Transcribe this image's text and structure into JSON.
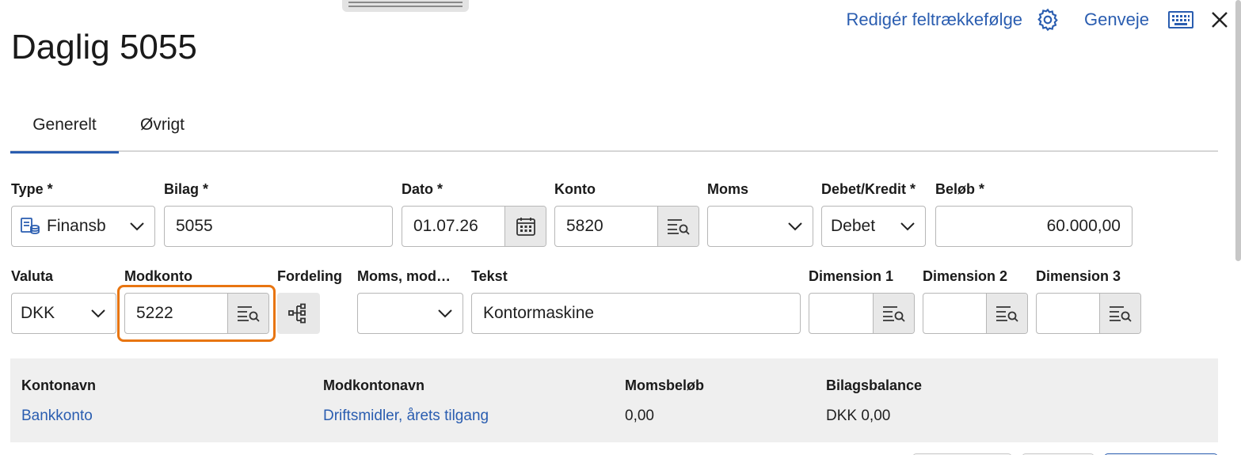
{
  "header": {
    "title": "Daglig 5055",
    "edit_order_label": "Redigér feltrækkefølge",
    "shortcuts_label": "Genveje"
  },
  "tabs": [
    {
      "label": "Generelt",
      "active": true
    },
    {
      "label": "Øvrigt",
      "active": false
    }
  ],
  "row1": {
    "type": {
      "label": "Type *",
      "value": "Finansb"
    },
    "bilag": {
      "label": "Bilag *",
      "value": "5055"
    },
    "dato": {
      "label": "Dato *",
      "value": "01.07.26"
    },
    "konto": {
      "label": "Konto",
      "value": "5820"
    },
    "moms": {
      "label": "Moms",
      "value": ""
    },
    "debet_kredit": {
      "label": "Debet/Kredit *",
      "value": "Debet"
    },
    "belob": {
      "label": "Beløb *",
      "value": "60.000,00"
    }
  },
  "row2": {
    "valuta": {
      "label": "Valuta",
      "value": "DKK"
    },
    "modkonto": {
      "label": "Modkonto",
      "value": "5222"
    },
    "fordeling": {
      "label": "Fordeling"
    },
    "moms_mod": {
      "label": "Moms, mod…",
      "value": ""
    },
    "tekst": {
      "label": "Tekst",
      "value": "Kontormaskine"
    },
    "dim1": {
      "label": "Dimension 1",
      "value": ""
    },
    "dim2": {
      "label": "Dimension 2",
      "value": ""
    },
    "dim3": {
      "label": "Dimension 3",
      "value": ""
    }
  },
  "summary": {
    "kontonavn": {
      "label": "Kontonavn",
      "value": "Bankkonto"
    },
    "modkontonavn": {
      "label": "Modkontonavn",
      "value": "Driftsmidler, årets tilgang"
    },
    "momsbelob": {
      "label": "Momsbeløb",
      "value": "0,00"
    },
    "bilagsbalance": {
      "label": "Bilagsbalance",
      "value": "DKK 0,00"
    }
  },
  "colors": {
    "accent": "#2a5db0",
    "focus": "#e87511"
  }
}
